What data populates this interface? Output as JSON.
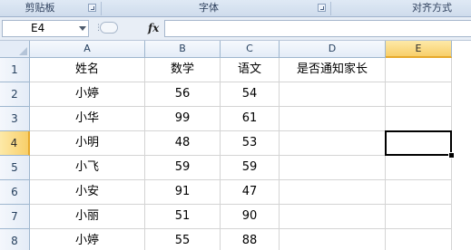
{
  "ribbon": {
    "groups": [
      {
        "label": "剪贴板"
      },
      {
        "label": "字体"
      },
      {
        "label": "对齐方式"
      }
    ]
  },
  "formula_bar": {
    "name_box": "E4",
    "fx_label": "fx",
    "formula_value": ""
  },
  "sheet": {
    "columns": [
      "A",
      "B",
      "C",
      "D",
      "E"
    ],
    "active_cell": "E4",
    "rows": [
      {
        "row_number": "1",
        "cells": [
          "姓名",
          "数学",
          "语文",
          "是否通知家长",
          ""
        ]
      },
      {
        "row_number": "2",
        "cells": [
          "小婷",
          "56",
          "54",
          "",
          ""
        ]
      },
      {
        "row_number": "3",
        "cells": [
          "小华",
          "99",
          "61",
          "",
          ""
        ]
      },
      {
        "row_number": "4",
        "cells": [
          "小明",
          "48",
          "53",
          "",
          ""
        ]
      },
      {
        "row_number": "5",
        "cells": [
          "小飞",
          "59",
          "59",
          "",
          ""
        ]
      },
      {
        "row_number": "6",
        "cells": [
          "小安",
          "91",
          "47",
          "",
          ""
        ]
      },
      {
        "row_number": "7",
        "cells": [
          "小丽",
          "51",
          "90",
          "",
          ""
        ]
      },
      {
        "row_number": "8",
        "cells": [
          "小婷",
          "55",
          "88",
          "",
          ""
        ]
      }
    ]
  },
  "colors": {
    "active_header": "#f8cf6a",
    "header_bg": "#e4ecf7",
    "gridline": "#d4d4d4"
  }
}
